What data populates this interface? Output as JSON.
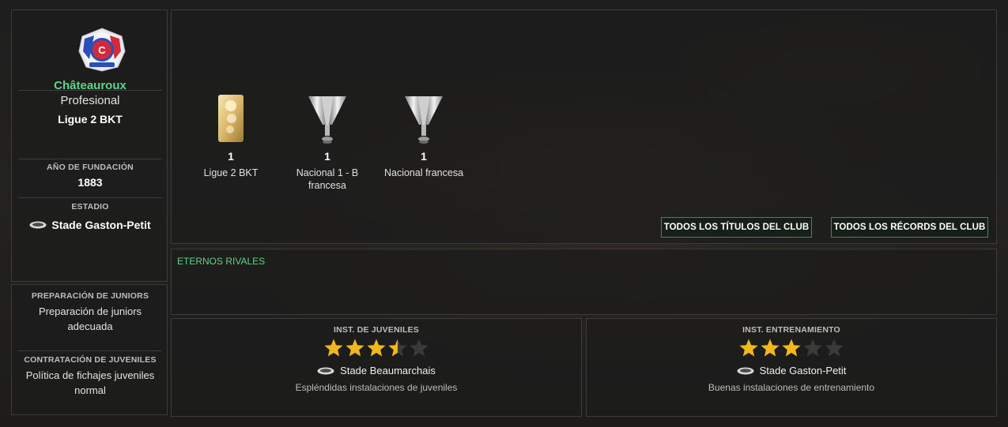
{
  "club": {
    "name": "Châteauroux",
    "status": "Profesional",
    "league": "Ligue 2 BKT",
    "founded_label": "AÑO DE FUNDACIÓN",
    "founded_value": "1883",
    "stadium_label": "ESTADIO",
    "stadium_name": "Stade Gaston-Petit"
  },
  "juniors": {
    "prep_label": "PREPARACIÓN DE JUNIORS",
    "prep_value": "Preparación de juniors adecuada",
    "recruit_label": "CONTRATACIÓN DE JUVENILES",
    "recruit_value": "Política de fichajes juveniles normal"
  },
  "trophies": [
    {
      "count": "1",
      "name": "Ligue 2 BKT",
      "icon": "gold-trophy-icon"
    },
    {
      "count": "1",
      "name": "Nacional 1 - B francesa",
      "icon": "silver-cup-icon"
    },
    {
      "count": "1",
      "name": "Nacional francesa",
      "icon": "silver-cup-icon"
    }
  ],
  "buttons": {
    "all_titles": "TODOS LOS TÍTULOS DEL CLUB",
    "all_records": "TODOS LOS RÉCORDS DEL CLUB"
  },
  "rivals": {
    "title": "ETERNOS RIVALES"
  },
  "youth_facilities": {
    "label": "INST. DE JUVENILES",
    "rating": 3.5,
    "max_rating": 5,
    "stadium": "Stade Beaumarchais",
    "description": "Espléndidas instalaciones de juveniles"
  },
  "training_facilities": {
    "label": "INST. ENTRENAMIENTO",
    "rating": 3,
    "max_rating": 5,
    "stadium": "Stade Gaston-Petit",
    "description": "Buenas instalaciones de entrenamiento"
  },
  "colors": {
    "accent_green": "#5fd38a",
    "star_gold": "#f0b81c",
    "star_empty": "#3a3a3a"
  }
}
